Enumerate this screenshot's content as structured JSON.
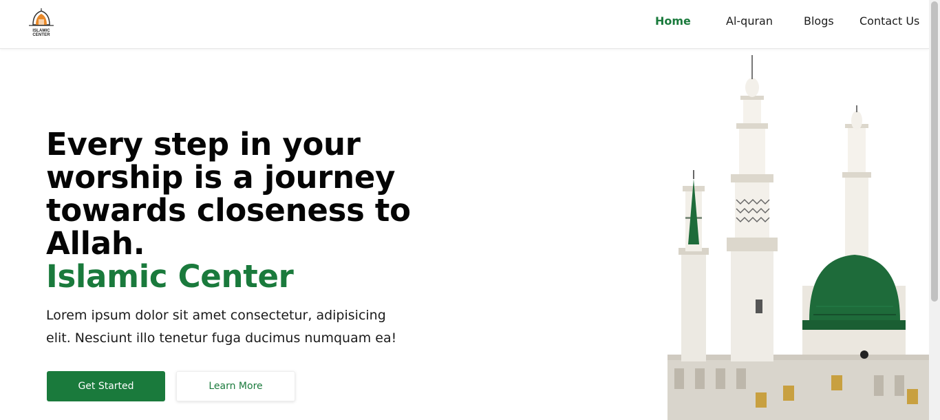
{
  "brand": {
    "logo_text": "ISLAMIC CENTER"
  },
  "nav": {
    "items": [
      {
        "label": "Home",
        "active": true
      },
      {
        "label": "Al-quran",
        "active": false
      },
      {
        "label": "Blogs",
        "active": false
      },
      {
        "label": "Contact Us",
        "active": false
      }
    ]
  },
  "hero": {
    "title": "Every step in your worship is a journey towards closeness to Allah.",
    "subtitle": "Islamic Center",
    "description": "Lorem ipsum dolor sit amet consectetur, adipisicing elit. Nesciunt illo tenetur fuga ducimus numquam ea!",
    "primary_button": "Get Started",
    "secondary_button": "Learn More"
  },
  "colors": {
    "accent": "#1a7a3c",
    "dome": "#1e6b3a",
    "text": "#111111"
  },
  "icons": {
    "logo": "mosque-dome-logo-icon",
    "hero_image": "mosque-minarets-illustration"
  }
}
